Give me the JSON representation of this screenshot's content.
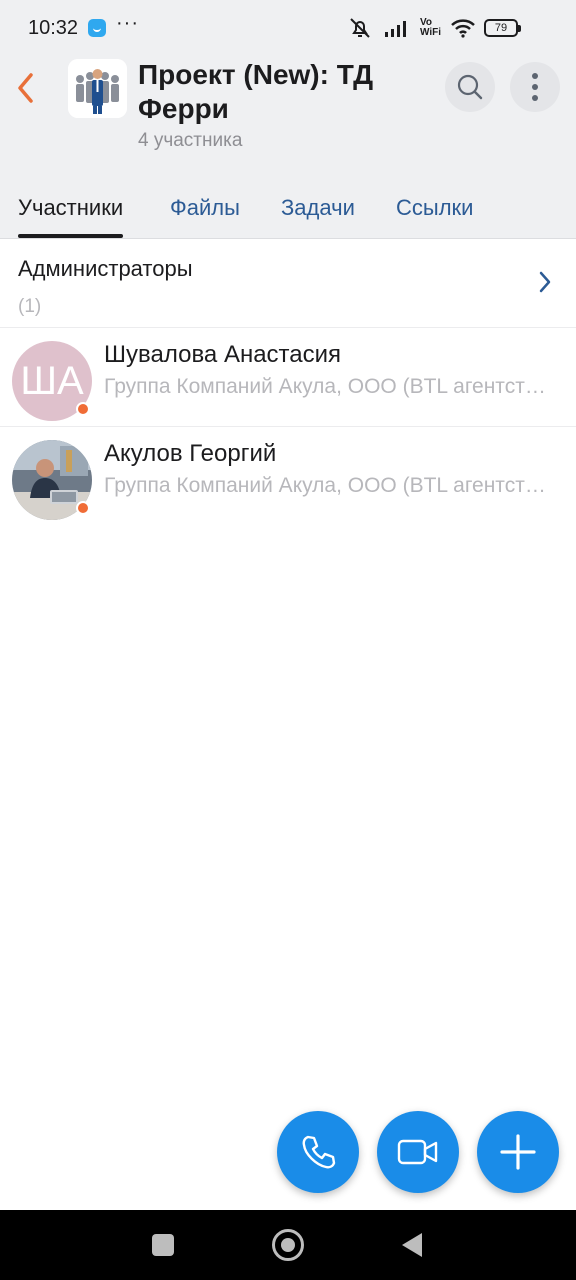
{
  "status_bar": {
    "time": "10:32",
    "dots": "···",
    "vo": "Vo",
    "wifi_label": "WiFi",
    "battery": "79",
    "icons": [
      "app-notification-icon",
      "mute-bell-icon",
      "signal-icon",
      "vowifi-icon",
      "wifi-icon",
      "battery-icon"
    ]
  },
  "header": {
    "title": "Проект (New): ТД Ферри",
    "subtitle": "4 участника",
    "back_icon": "chevron-left-icon",
    "search_icon": "search-icon",
    "more_icon": "more-vertical-icon"
  },
  "tabs": [
    {
      "label": "Участники",
      "active": true
    },
    {
      "label": "Файлы",
      "active": false
    },
    {
      "label": "Задачи",
      "active": false
    },
    {
      "label": "Ссылки",
      "active": false
    }
  ],
  "admins": {
    "label": "Администраторы",
    "count": "(1)"
  },
  "members": [
    {
      "initials": "ША",
      "name": "Шувалова Анастасия",
      "org": "Группа Компаний Акула, ООО (BTL агентство)",
      "status_color": "#f06c36"
    },
    {
      "initials": "",
      "name": "Акулов Георгий",
      "org": "Группа Компаний Акула, ООО (BTL агентство)",
      "status_color": "#f06c36"
    }
  ],
  "fabs": {
    "call_icon": "phone-icon",
    "video_icon": "video-camera-icon",
    "add_icon": "plus-icon"
  },
  "colors": {
    "accent": "#1a8ce8",
    "back_arrow": "#e8703a",
    "tab_link": "#2c5b95",
    "header_bg": "#eff0f2",
    "status_dot": "#f06c36"
  }
}
